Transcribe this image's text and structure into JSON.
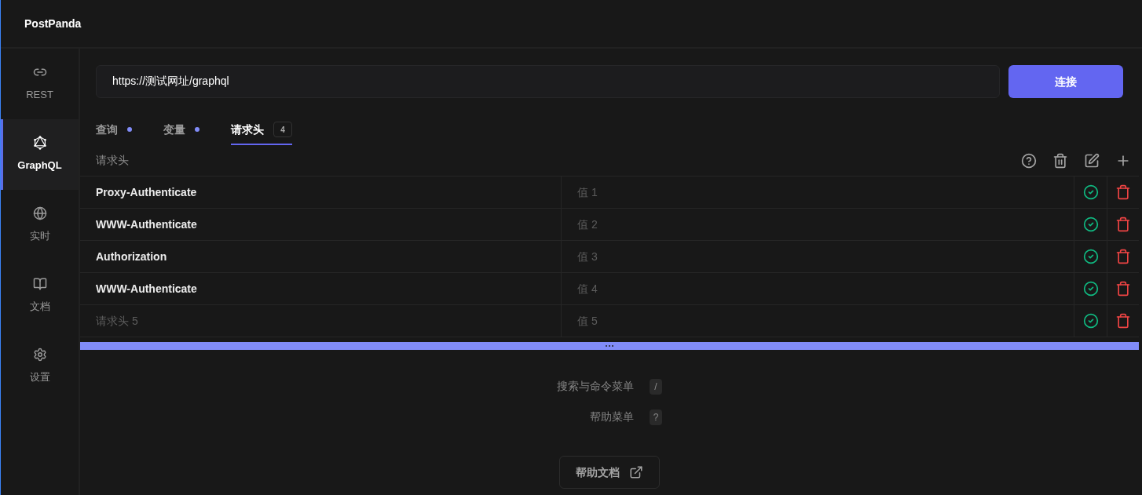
{
  "app": {
    "title": "PostPanda"
  },
  "sidebar": {
    "items": [
      {
        "label": "REST",
        "selected": false
      },
      {
        "label": "GraphQL",
        "selected": true
      },
      {
        "label": "实时",
        "selected": false
      },
      {
        "label": "文档",
        "selected": false
      },
      {
        "label": "设置",
        "selected": false
      }
    ]
  },
  "url_bar": {
    "value": "https://测试网址/graphql",
    "button": "连接"
  },
  "tabs": [
    {
      "label": "查询",
      "modified": true,
      "selected": false
    },
    {
      "label": "变量",
      "modified": true,
      "selected": false
    },
    {
      "label": "请求头",
      "count": "4",
      "selected": true
    }
  ],
  "headers": {
    "title": "请求头",
    "rows": [
      {
        "key": {
          "value": "Proxy-Authenticate"
        },
        "value": {
          "placeholder": "值 1"
        },
        "enabled": true
      },
      {
        "key": {
          "value": "WWW-Authenticate"
        },
        "value": {
          "placeholder": "值 2"
        },
        "enabled": true
      },
      {
        "key": {
          "value": "Authorization"
        },
        "value": {
          "placeholder": "值 3"
        },
        "enabled": true
      },
      {
        "key": {
          "value": "WWW-Authenticate"
        },
        "value": {
          "placeholder": "值 4"
        },
        "enabled": true
      },
      {
        "key": {
          "placeholder": "请求头 5"
        },
        "value": {
          "placeholder": "值 5"
        },
        "enabled": true
      }
    ]
  },
  "shortcuts": [
    {
      "label": "搜索与命令菜单",
      "key": "/"
    },
    {
      "label": "帮助菜单",
      "key": "?"
    }
  ],
  "help_button": {
    "label": "帮助文档"
  }
}
